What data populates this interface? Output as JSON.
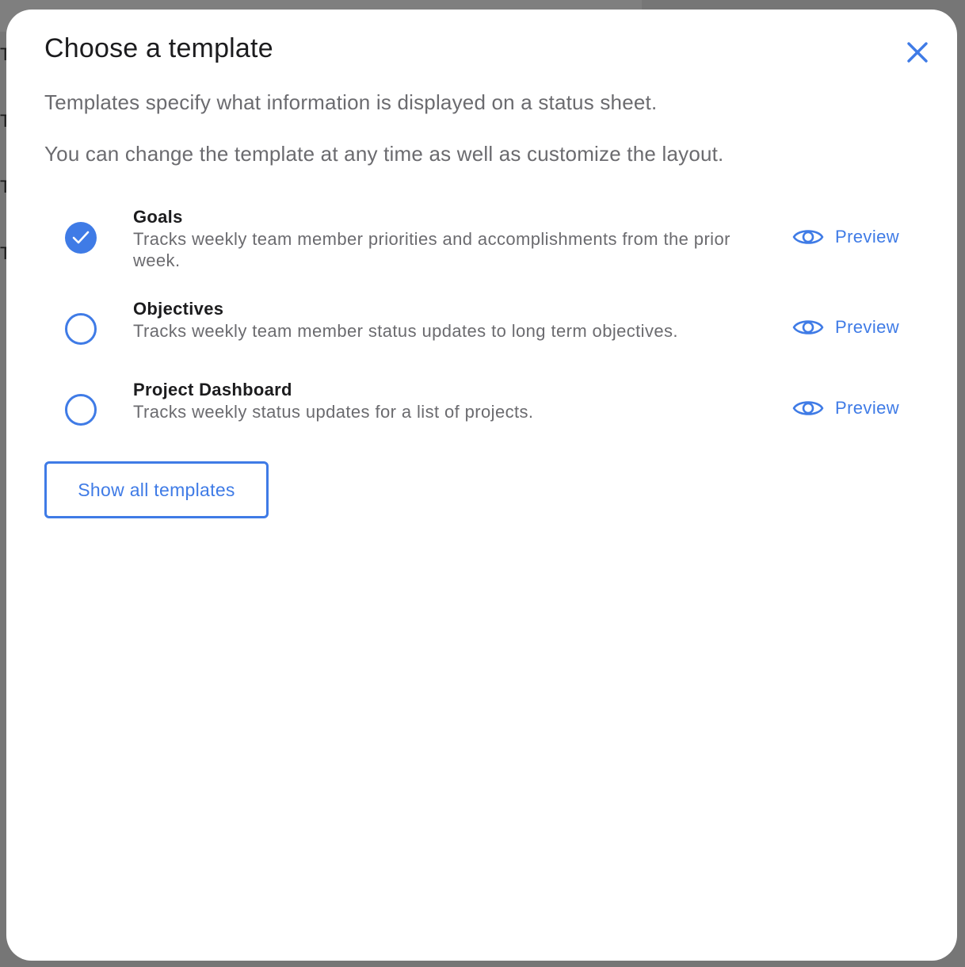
{
  "background": {
    "letters": [
      "T",
      "T",
      "T",
      "T"
    ]
  },
  "modal": {
    "title": "Choose a template",
    "close_icon": "close-icon",
    "intro": [
      "Templates specify what information is displayed on a status sheet.",
      "You can change the template at any time as well as customize the layout."
    ],
    "options": [
      {
        "name": "Goals",
        "description": "Tracks weekly team member priorities and accomplishments from the prior week.",
        "selected": true,
        "preview_label": "Preview",
        "preview_icon": "eye-icon"
      },
      {
        "name": "Objectives",
        "description": "Tracks weekly team member status updates to long term objectives.",
        "selected": false,
        "preview_label": "Preview",
        "preview_icon": "eye-icon"
      },
      {
        "name": "Project Dashboard",
        "description": "Tracks weekly status updates for a list of projects.",
        "selected": false,
        "preview_label": "Preview",
        "preview_icon": "eye-icon"
      }
    ],
    "show_all_label": "Show all templates"
  },
  "colors": {
    "accent": "#3f7be6",
    "title_text": "#1c1c1e",
    "body_text": "#6b6b6f",
    "overlay": "#767676",
    "modal_bg": "#ffffff"
  }
}
